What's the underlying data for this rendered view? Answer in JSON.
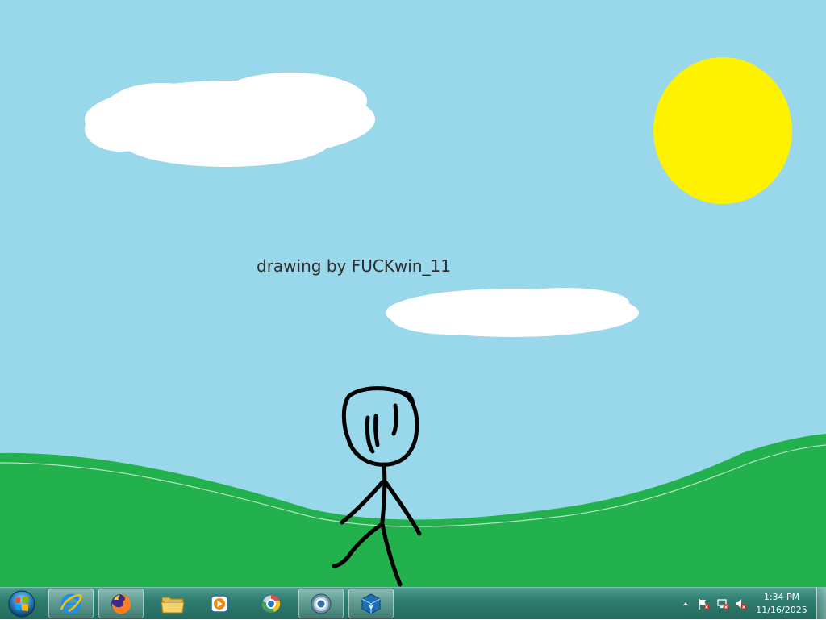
{
  "desktop": {
    "caption": "drawing by FUCKwin_11",
    "colors": {
      "sky": "#99d8ea",
      "grass": "#22b14c",
      "sun": "#fff200",
      "cloud": "#ffffff"
    }
  },
  "taskbar": {
    "start_icon": "windows-orb-icon",
    "pinned": [
      {
        "name": "internet-explorer",
        "icon": "internet-explorer-icon"
      },
      {
        "name": "firefox",
        "icon": "firefox-icon"
      },
      {
        "name": "file-explorer",
        "icon": "folder-icon"
      },
      {
        "name": "media-player",
        "icon": "media-player-icon"
      },
      {
        "name": "chrome-old",
        "icon": "chrome-icon"
      },
      {
        "name": "chrome-active",
        "icon": "chrome-icon"
      },
      {
        "name": "virtualbox",
        "icon": "virtualbox-icon"
      }
    ],
    "tray": {
      "time": "1:34 PM",
      "date": "11/16/2025"
    }
  }
}
